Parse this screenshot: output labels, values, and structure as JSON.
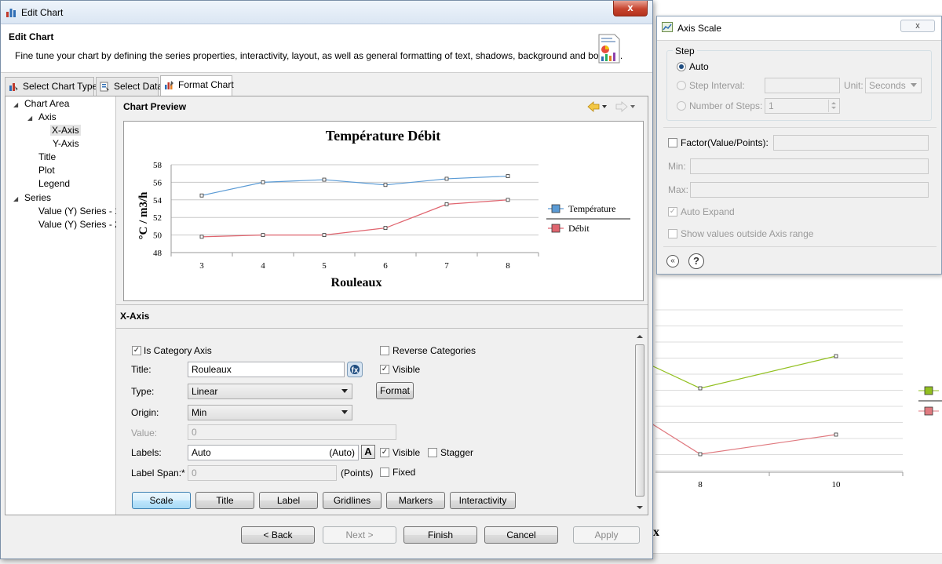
{
  "edit_chart": {
    "window_title": "Edit Chart",
    "close_label": "x",
    "header_title": "Edit Chart",
    "header_description": "Fine tune your chart by defining the series properties, interactivity, layout, as well as general formatting of text, shadows, background and borders.",
    "tabs": [
      {
        "label": "Select Chart Type",
        "icon": "chart-type-icon"
      },
      {
        "label": "Select Data",
        "icon": "select-data-icon"
      },
      {
        "label": "Format Chart",
        "icon": "format-chart-icon",
        "active": true
      }
    ],
    "tree": [
      {
        "label": "Chart Area",
        "expanded": true
      },
      {
        "label": "Axis",
        "expanded": true
      },
      {
        "label": "X-Axis",
        "selected": true
      },
      {
        "label": "Y-Axis"
      },
      {
        "label": "Title"
      },
      {
        "label": "Plot"
      },
      {
        "label": "Legend"
      },
      {
        "label": "Series",
        "expanded": true
      },
      {
        "label": "Value (Y) Series - 1"
      },
      {
        "label": "Value (Y) Series - 2"
      }
    ],
    "chart_preview_title": "Chart Preview",
    "section_title": "X-Axis",
    "form": {
      "is_category_axis": {
        "label": "Is Category Axis",
        "checked": true
      },
      "reverse_categories": {
        "label": "Reverse Categories",
        "checked": false
      },
      "title_label": "Title:",
      "title_value": "Rouleaux",
      "title_visible": {
        "label": "Visible",
        "checked": true
      },
      "type_label": "Type:",
      "type_value": "Linear",
      "format_button": "Format",
      "origin_label": "Origin:",
      "origin_value": "Min",
      "value_label": "Value:",
      "value_value": "0",
      "labels_label": "Labels:",
      "labels_value": "Auto",
      "labels_auto_hint": "(Auto)",
      "labels_font_glyph": "A",
      "labels_visible": {
        "label": "Visible",
        "checked": true
      },
      "stagger": {
        "label": "Stagger",
        "checked": false
      },
      "label_span_label": "Label Span:*",
      "label_span_value": "0",
      "label_span_unit": "(Points)",
      "fixed": {
        "label": "Fixed",
        "checked": false
      }
    },
    "sub_buttons": [
      "Scale",
      "Title",
      "Label",
      "Gridlines",
      "Markers",
      "Interactivity"
    ],
    "footer_buttons": {
      "back": "< Back",
      "next": "Next >",
      "finish": "Finish",
      "cancel": "Cancel",
      "apply": "Apply"
    }
  },
  "axis_scale": {
    "window_title": "Axis Scale",
    "close_label": "x",
    "step_group_title": "Step",
    "auto_label": "Auto",
    "step_interval_label": "Step Interval:",
    "step_interval_value": "",
    "unit_label": "Unit:",
    "unit_value": "Seconds",
    "number_of_steps_label": "Number of Steps:",
    "number_of_steps_value": "1",
    "factor_label": "Factor(Value/Points):",
    "min_label": "Min:",
    "max_label": "Max:",
    "auto_expand_label": "Auto Expand",
    "auto_expand_checked": true,
    "show_outside_label": "Show values outside Axis range",
    "collapse_icon": "collapse-icon",
    "help_icon": "help-icon",
    "help_glyph": "?",
    "collapse_glyph": "«"
  },
  "background_chart": {
    "x_tick_labels": [
      "8",
      "10"
    ],
    "partial_title_letter": "x"
  },
  "colors": {
    "temperature": "#5b9bd5",
    "debit": "#e0656f",
    "bg_series_green": "#92c020",
    "bg_series_pink": "#e07a80"
  },
  "chart_data": {
    "type": "line",
    "title": "Température Débit",
    "xlabel": "Rouleaux",
    "ylabel": "°C / m3/h",
    "categories": [
      "3",
      "4",
      "5",
      "6",
      "7",
      "8"
    ],
    "ylim": [
      48,
      58
    ],
    "yticks": [
      48,
      50,
      52,
      54,
      56,
      58
    ],
    "grid": true,
    "legend_position": "right",
    "series": [
      {
        "name": "Température",
        "values": [
          54.5,
          56.0,
          56.3,
          55.7,
          56.4,
          56.7
        ]
      },
      {
        "name": "Débit",
        "values": [
          49.8,
          50.0,
          50.0,
          50.8,
          53.5,
          54.0
        ]
      }
    ]
  }
}
